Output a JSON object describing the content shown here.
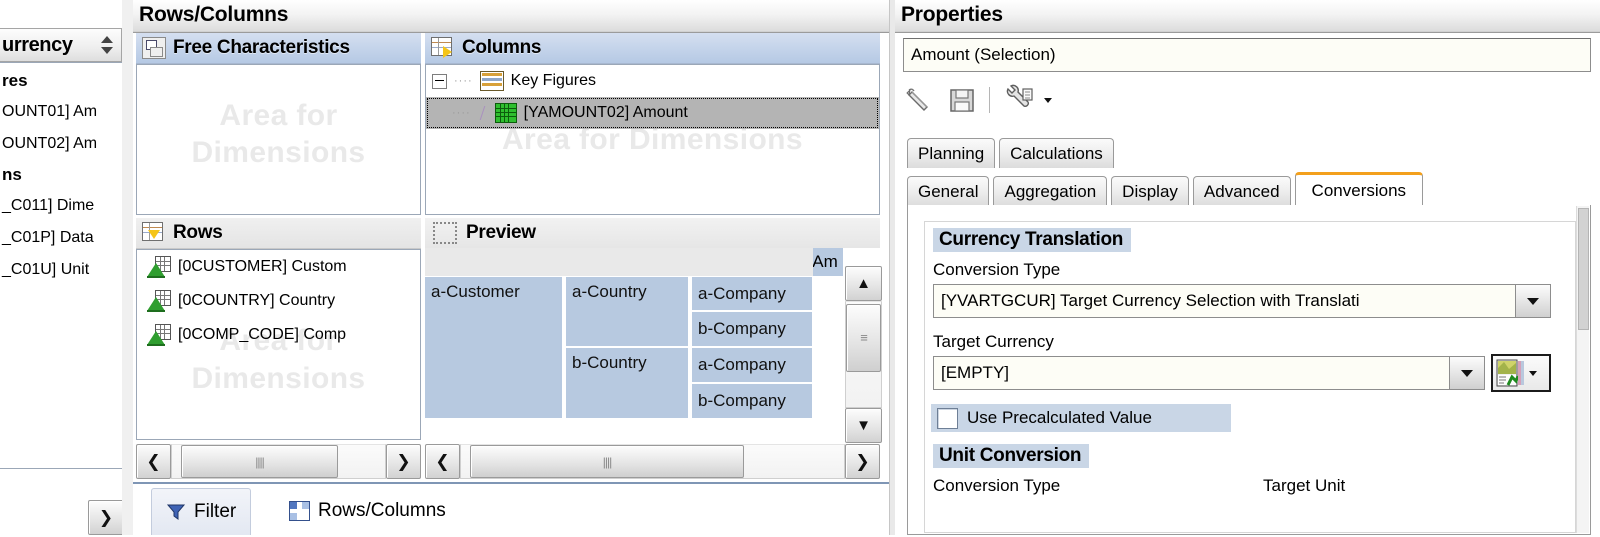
{
  "left_panel": {
    "header_label": "urrency",
    "sort_icon": "sort-updown-icon",
    "groups": [
      {
        "label": "res",
        "items": [
          {
            "label": "OUNT01] Am"
          },
          {
            "label": "OUNT02] Am"
          }
        ]
      },
      {
        "label": "ns",
        "items": [
          {
            "label": "_C011] Dime"
          },
          {
            "label": "_C01P] Data"
          },
          {
            "label": "_C01U] Unit"
          }
        ]
      }
    ],
    "scroll_right_label": "❯"
  },
  "rows_columns_panel": {
    "title": "Rows/Columns",
    "free_characteristics": {
      "header": "Free Characteristics",
      "icon": "free-characteristics-icon",
      "ghost_line1": "Area for",
      "ghost_line2": "Dimensions",
      "items": []
    },
    "columns": {
      "header": "Columns",
      "icon": "columns-icon",
      "ghost": "Area for Dimensions",
      "tree": [
        {
          "label": "Key Figures",
          "icon": "key-figures-icon",
          "level": 0,
          "expander": "collapse",
          "selected": false
        },
        {
          "label": "[YAMOUNT02] Amount",
          "icon": "key-figure-item-icon",
          "level": 1,
          "expander": "none",
          "selected": true
        }
      ]
    },
    "rows": {
      "header": "Rows",
      "icon": "rows-icon",
      "ghost_line1": "Area for",
      "ghost_line2": "Dimensions",
      "items": [
        {
          "label": "[0CUSTOMER] Custom",
          "icon": "characteristic-icon"
        },
        {
          "label": "[0COUNTRY] Country",
          "icon": "characteristic-icon"
        },
        {
          "label": "[0COMP_CODE] Comp",
          "icon": "characteristic-icon"
        }
      ],
      "scroll_left": "❮",
      "scroll_right": "❯",
      "thumb_grip": "||||"
    },
    "preview": {
      "header": "Preview",
      "icon": "preview-icon",
      "column_header_partial": "Am",
      "table": {
        "rows": [
          {
            "customer": "a-Customer",
            "country": "a-Country",
            "company": "a-Company"
          },
          {
            "customer": "",
            "country": "",
            "company": "b-Company"
          },
          {
            "customer": "",
            "country": "b-Country",
            "company": "a-Company"
          },
          {
            "customer": "",
            "country": "",
            "company": "b-Company"
          }
        ]
      },
      "scroll_left": "❮",
      "scroll_right": "❯",
      "thumb_grip": "||||",
      "vscroll_up": "▲",
      "vscroll_down": "▼"
    },
    "bottom_tabs": [
      {
        "label": "Filter",
        "icon": "filter-icon",
        "active": true
      },
      {
        "label": "Rows/Columns",
        "icon": "rows-columns-icon",
        "active": false
      }
    ]
  },
  "properties_panel": {
    "title": "Properties",
    "object_name": "Amount (Selection)",
    "toolbar": [
      {
        "name": "rename-pencil-icon"
      },
      {
        "name": "save-icon"
      },
      {
        "name": "settings-wrench-icon"
      }
    ],
    "tabs_row1": [
      {
        "label": "Planning",
        "active": false
      },
      {
        "label": "Calculations",
        "active": false
      }
    ],
    "tabs_row2": [
      {
        "label": "General",
        "active": false
      },
      {
        "label": "Aggregation",
        "active": false
      },
      {
        "label": "Display",
        "active": false
      },
      {
        "label": "Advanced",
        "active": false
      },
      {
        "label": "Conversions",
        "active": true
      }
    ],
    "active_tab_accent": "#f3a01c",
    "currency_translation": {
      "group_title": "Currency Translation",
      "conversion_type_label": "Conversion Type",
      "conversion_type_value": "[YVARTGCUR] Target Currency Selection with Translati",
      "target_currency_label": "Target Currency",
      "target_currency_value": "[EMPTY]",
      "variable_button_icon": "variable-picker-icon",
      "use_precalculated_label": "Use Precalculated Value",
      "use_precalculated_checked": false
    },
    "unit_conversion": {
      "group_title": "Unit Conversion",
      "conversion_type_label": "Conversion Type",
      "target_unit_label": "Target Unit"
    }
  }
}
